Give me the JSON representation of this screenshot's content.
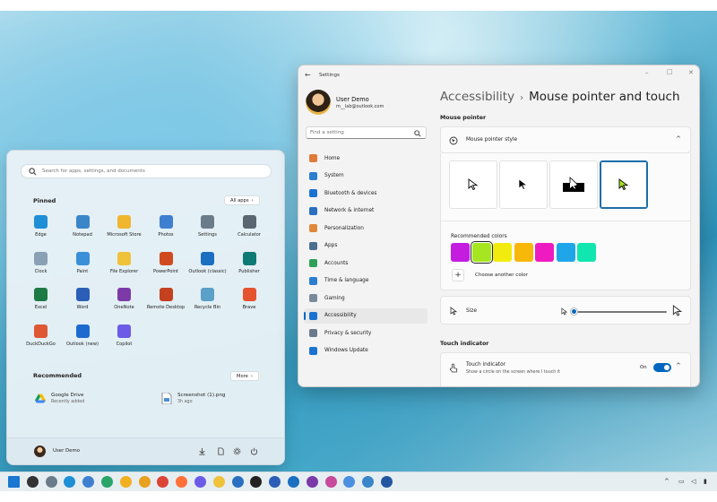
{
  "start_menu": {
    "search_placeholder": "Search for apps, settings, and documents",
    "pinned_title": "Pinned",
    "all_apps_label": "All apps",
    "pinned": [
      {
        "label": "Edge",
        "icon": "edge-icon",
        "color": "#1f8fd6"
      },
      {
        "label": "Notepad",
        "icon": "notepad-icon",
        "color": "#3a86c8"
      },
      {
        "label": "Microsoft Store",
        "icon": "store-icon",
        "color": "#f1b62f"
      },
      {
        "label": "Photos",
        "icon": "photos-icon",
        "color": "#3f7fd0"
      },
      {
        "label": "Settings",
        "icon": "gear-icon",
        "color": "#6a7b8a"
      },
      {
        "label": "Calculator",
        "icon": "calculator-icon",
        "color": "#5a6672"
      },
      {
        "label": "Clock",
        "icon": "clock-icon",
        "color": "#8aa0b5"
      },
      {
        "label": "Paint",
        "icon": "paint-icon",
        "color": "#3a8fd8"
      },
      {
        "label": "File Explorer",
        "icon": "folder-icon",
        "color": "#f0c23a"
      },
      {
        "label": "PowerPoint",
        "icon": "powerpoint-icon",
        "color": "#d04a1d"
      },
      {
        "label": "Outlook (classic)",
        "icon": "outlook-icon",
        "color": "#1a6fc0"
      },
      {
        "label": "Publisher",
        "icon": "publisher-icon",
        "color": "#0d7a73"
      },
      {
        "label": "Excel",
        "icon": "excel-icon",
        "color": "#1e7a44"
      },
      {
        "label": "Word",
        "icon": "word-icon",
        "color": "#2b5eb6"
      },
      {
        "label": "OneNote",
        "icon": "onenote-icon",
        "color": "#7b3aa8"
      },
      {
        "label": "Remote Desktop",
        "icon": "remote-desktop-icon",
        "color": "#c4401e"
      },
      {
        "label": "Recycle Bin",
        "icon": "recycle-bin-icon",
        "color": "#5aa0c8"
      },
      {
        "label": "Brave",
        "icon": "brave-icon",
        "color": "#e5532e"
      },
      {
        "label": "DuckDuckGo",
        "icon": "duckduckgo-icon",
        "color": "#de5833"
      },
      {
        "label": "Outlook (new)",
        "icon": "outlook-new-icon",
        "color": "#1c6ad0"
      },
      {
        "label": "Copilot",
        "icon": "copilot-icon",
        "color": "#6b5be6"
      }
    ],
    "recommended_title": "Recommended",
    "more_label": "More",
    "recommended": [
      {
        "title": "Google Drive",
        "subtitle": "Recently added",
        "icon": "google-drive-icon"
      },
      {
        "title": "Screenshot (1).png",
        "subtitle": "3h ago",
        "icon": "image-file-icon"
      }
    ],
    "user_name": "User Demo"
  },
  "settings": {
    "window_title": "Settings",
    "profile": {
      "name": "User Demo",
      "email": "m__lab@outlook.com"
    },
    "find_placeholder": "Find a setting",
    "nav": [
      {
        "label": "Home",
        "icon": "home-icon",
        "color": "#e07b39"
      },
      {
        "label": "System",
        "icon": "system-icon",
        "color": "#2a7fd0"
      },
      {
        "label": "Bluetooth & devices",
        "icon": "bluetooth-icon",
        "color": "#1a73d0"
      },
      {
        "label": "Network & internet",
        "icon": "wifi-icon",
        "color": "#2a6fc0"
      },
      {
        "label": "Personalization",
        "icon": "brush-icon",
        "color": "#e0883a"
      },
      {
        "label": "Apps",
        "icon": "apps-icon",
        "color": "#4a6f90"
      },
      {
        "label": "Accounts",
        "icon": "accounts-icon",
        "color": "#2ea05a"
      },
      {
        "label": "Time & language",
        "icon": "time-language-icon",
        "color": "#2a7fd0"
      },
      {
        "label": "Gaming",
        "icon": "gaming-icon",
        "color": "#7a8a9a"
      },
      {
        "label": "Accessibility",
        "icon": "accessibility-icon",
        "color": "#1a73d0"
      },
      {
        "label": "Privacy & security",
        "icon": "shield-icon",
        "color": "#6a7a8a"
      },
      {
        "label": "Windows Update",
        "icon": "windows-update-icon",
        "color": "#1a73d0"
      }
    ],
    "active_nav": 9,
    "breadcrumb_parent": "Accessibility",
    "breadcrumb_separator": "›",
    "breadcrumb_current": "Mouse pointer and touch",
    "mouse_pointer_section": "Mouse pointer",
    "pointer_style_label": "Mouse pointer style",
    "recommended_colors_label": "Recommended colors",
    "recommended_colors": [
      "#c41de0",
      "#a6e620",
      "#f2ec0e",
      "#f7b80a",
      "#ee1cc0",
      "#1ea6e8",
      "#12e6b0"
    ],
    "selected_color": 1,
    "choose_color_label": "Choose another color",
    "size_label": "Size",
    "size_value": 1,
    "touch_section": "Touch indicator",
    "touch_indicator_label": "Touch indicator",
    "touch_indicator_desc": "Show a circle on the screen where I touch it",
    "touch_toggle_state": "On"
  },
  "taskbar": {
    "icons": [
      "windows-icon",
      "taskview-icon",
      "settings-icon",
      "edge-icon",
      "photos-icon",
      "edge-beta-icon",
      "canary-icon",
      "chrome-canary-icon",
      "chrome-icon",
      "firefox-icon",
      "copilot-icon",
      "explorer-icon",
      "store-icon",
      "terminal-icon",
      "word-icon",
      "outlook-icon",
      "onenote-icon",
      "snip-icon",
      "copilot2-icon",
      "notepad-icon",
      "powershell-icon"
    ]
  }
}
